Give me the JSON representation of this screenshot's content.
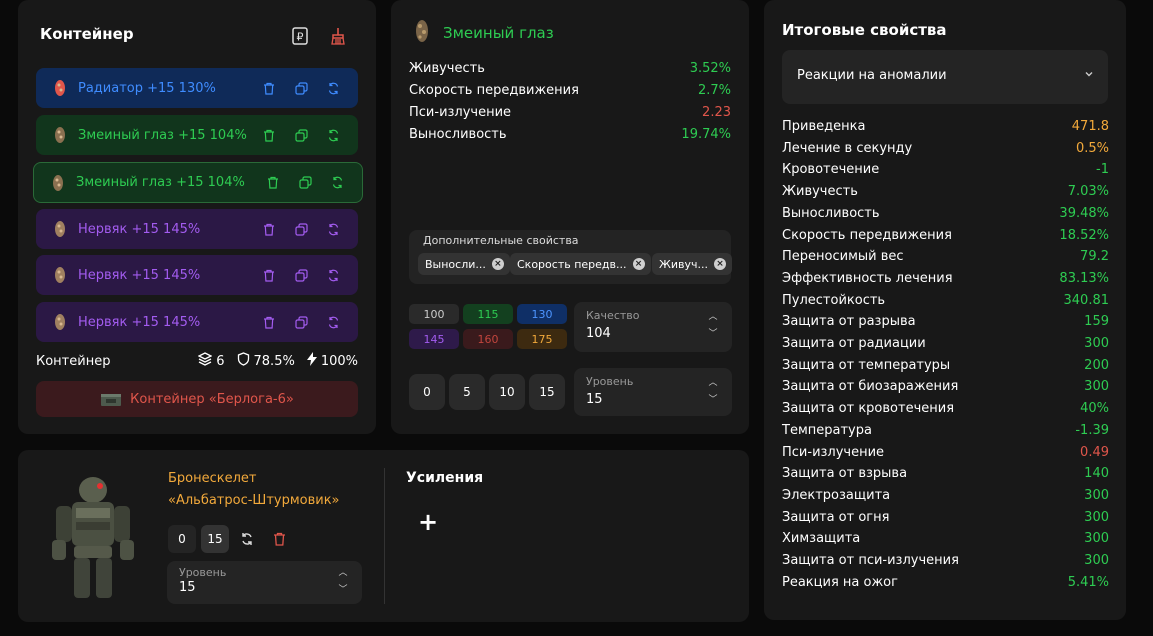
{
  "container": {
    "title": "Контейнер",
    "rows": [
      {
        "icon": "radiator-artifact-icon",
        "label": "Радиатор  +15  130%",
        "color": "blue"
      },
      {
        "icon": "snake-eye-artifact-icon",
        "label": "Змеиный глаз  +15  104%",
        "color": "green"
      },
      {
        "icon": "snake-eye-artifact-icon",
        "label": "Змеиный глаз  +15  104%",
        "color": "green"
      },
      {
        "icon": "nervyak-artifact-icon",
        "label": "Нервяк  +15  145%",
        "color": "purple"
      },
      {
        "icon": "nervyak-artifact-icon",
        "label": "Нервяк  +15  145%",
        "color": "purple"
      },
      {
        "icon": "nervyak-artifact-icon",
        "label": "Нервяк  +15  145%",
        "color": "purple"
      }
    ],
    "footer_label": "Контейнер",
    "slots": "6",
    "protection": "78.5%",
    "efficiency": "100%",
    "select_button": "Контейнер «Берлога-6»"
  },
  "artifact": {
    "name": "Змеиный глаз",
    "stats": [
      {
        "k": "Живучесть",
        "v": "3.52%",
        "color": "#2ecc52"
      },
      {
        "k": "Скорость передвижения",
        "v": "2.7%",
        "color": "#2ecc52"
      },
      {
        "k": "Пси-излучение",
        "v": "2.23",
        "color": "#e0564b"
      },
      {
        "k": "Выносливость",
        "v": "19.74%",
        "color": "#2ecc52"
      }
    ],
    "extra_label": "Дополнительные свойства",
    "chips": [
      "Выносли...",
      "Скорость передв...",
      "Живуч..."
    ],
    "quality_presets": [
      "100",
      "115",
      "130",
      "145",
      "160",
      "175"
    ],
    "quality_label": "Качество",
    "quality_value": "104",
    "level_presets": [
      "0",
      "5",
      "10",
      "15"
    ],
    "level_label": "Уровень",
    "level_value": "15"
  },
  "totals": {
    "title": "Итоговые свойства",
    "dropdown": "Реакции на аномалии",
    "rows": [
      {
        "k": "Приведенка",
        "v": "471.8",
        "color": "#f2a93b"
      },
      {
        "k": "Лечение в секунду",
        "v": "0.5%",
        "color": "#f2a93b"
      },
      {
        "k": "Кровотечение",
        "v": "-1",
        "color": "#2ecc52"
      },
      {
        "k": "Живучесть",
        "v": "7.03%",
        "color": "#2ecc52"
      },
      {
        "k": "Выносливость",
        "v": "39.48%",
        "color": "#2ecc52"
      },
      {
        "k": "Скорость передвижения",
        "v": "18.52%",
        "color": "#2ecc52"
      },
      {
        "k": "Переносимый вес",
        "v": "79.2",
        "color": "#2ecc52"
      },
      {
        "k": "Эффективность лечения",
        "v": "83.13%",
        "color": "#2ecc52"
      },
      {
        "k": "Пулестойкость",
        "v": "340.81",
        "color": "#2ecc52"
      },
      {
        "k": "Защита от разрыва",
        "v": "159",
        "color": "#2ecc52"
      },
      {
        "k": "Защита от радиации",
        "v": "300",
        "color": "#2ecc52"
      },
      {
        "k": "Защита от температуры",
        "v": "200",
        "color": "#2ecc52"
      },
      {
        "k": "Защита от биозаражения",
        "v": "300",
        "color": "#2ecc52"
      },
      {
        "k": "Защита от кровотечения",
        "v": "40%",
        "color": "#2ecc52"
      },
      {
        "k": "Температура",
        "v": "-1.39",
        "color": "#2ecc52"
      },
      {
        "k": "Пси-излучение",
        "v": "0.49",
        "color": "#e0564b"
      },
      {
        "k": "Защита от взрыва",
        "v": "140",
        "color": "#2ecc52"
      },
      {
        "k": "Электрозащита",
        "v": "300",
        "color": "#2ecc52"
      },
      {
        "k": "Защита от огня",
        "v": "300",
        "color": "#2ecc52"
      },
      {
        "k": "Химзащита",
        "v": "300",
        "color": "#2ecc52"
      },
      {
        "k": "Защита от пси-излучения",
        "v": "300",
        "color": "#2ecc52"
      },
      {
        "k": "Реакция на ожог",
        "v": "5.41%",
        "color": "#2ecc52"
      }
    ]
  },
  "suit": {
    "name_line1": "Бронескелет",
    "name_line2": "«Альбатрос-Штурмовик»",
    "btn_min": "0",
    "btn_max": "15",
    "level_label": "Уровень",
    "level_value": "15",
    "upgrades_title": "Усиления",
    "add_symbol": "+"
  }
}
